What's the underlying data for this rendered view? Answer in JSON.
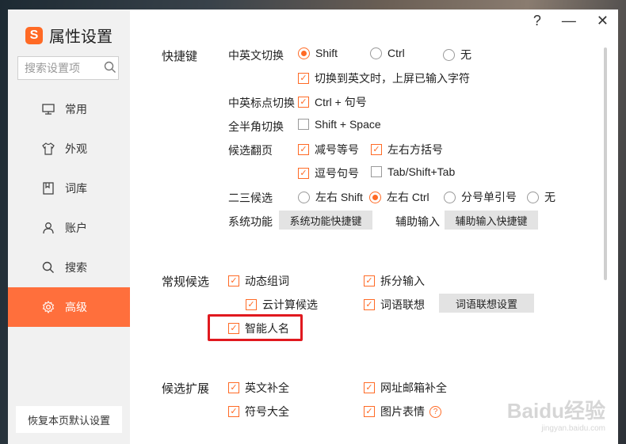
{
  "app": {
    "title": "属性设置",
    "logo_letter": "S"
  },
  "search": {
    "placeholder": "搜索设置项"
  },
  "sidebar": {
    "items": [
      {
        "label": "常用",
        "icon": "monitor-icon"
      },
      {
        "label": "外观",
        "icon": "shirt-icon"
      },
      {
        "label": "词库",
        "icon": "book-icon"
      },
      {
        "label": "账户",
        "icon": "user-icon"
      },
      {
        "label": "搜索",
        "icon": "search-icon"
      },
      {
        "label": "高级",
        "icon": "gear-icon",
        "active": true
      }
    ],
    "restore_label": "恢复本页默认设置"
  },
  "window_controls": {
    "help": "?",
    "minimize": "—",
    "close": "✕"
  },
  "shortcuts": {
    "title": "快捷键",
    "cn_en_switch": {
      "label": "中英文切换",
      "options": [
        "Shift",
        "Ctrl",
        "无"
      ],
      "selected": "Shift",
      "commit_option": "切换到英文时，上屏已输入字符"
    },
    "punct_switch": {
      "label": "中英标点切换",
      "option": "Ctrl + 句号"
    },
    "width_switch": {
      "label": "全半角切换",
      "option": "Shift + Space"
    },
    "paging": {
      "label": "候选翻页",
      "options": [
        "减号等号",
        "左右方括号",
        "逗号句号",
        "Tab/Shift+Tab"
      ]
    },
    "second_third": {
      "label": "二三候选",
      "options": [
        "左右 Shift",
        "左右 Ctrl",
        "分号单引号",
        "无"
      ],
      "selected": "左右 Ctrl"
    },
    "system": {
      "label": "系统功能",
      "button": "系统功能快捷键"
    },
    "assist": {
      "label": "辅助输入",
      "button": "辅助输入快捷键"
    }
  },
  "regular": {
    "title": "常规候选",
    "dynamic_phrase": "动态组词",
    "cloud_calc": "云计算候选",
    "smart_name": "智能人名",
    "split_input": "拆分输入",
    "word_assoc": "词语联想",
    "assoc_button": "词语联想设置"
  },
  "extension": {
    "title": "候选扩展",
    "english_complete": "英文补全",
    "url_email": "网址邮箱补全",
    "symbols": "符号大全",
    "image_emoji": "图片表情"
  },
  "watermark": {
    "text": "Baidu经验",
    "sub": "jingyan.baidu.com"
  },
  "colors": {
    "accent": "#ff6a25",
    "highlight": "#e0191f"
  }
}
